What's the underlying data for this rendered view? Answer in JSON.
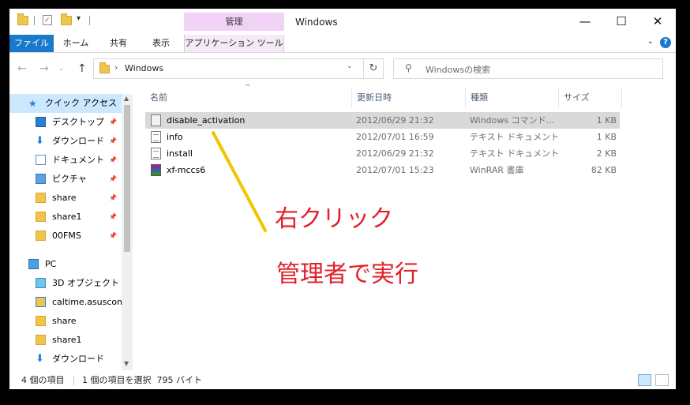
{
  "window": {
    "title": "Windows",
    "context_tab_header": "管理"
  },
  "ribbon": {
    "tabs": [
      "ファイル",
      "ホーム",
      "共有",
      "表示",
      "アプリケーション ツール"
    ]
  },
  "address": {
    "path": "Windows",
    "search_placeholder": "Windowsの検索"
  },
  "nav": {
    "items": [
      {
        "label": "クイック アクセス",
        "icon": "star-icon",
        "pinned": false
      },
      {
        "label": "デスクトップ",
        "icon": "desktop-icon",
        "pinned": true
      },
      {
        "label": "ダウンロード",
        "icon": "download-icon",
        "pinned": true
      },
      {
        "label": "ドキュメント",
        "icon": "document-icon",
        "pinned": true
      },
      {
        "label": "ピクチャ",
        "icon": "pictures-icon",
        "pinned": true
      },
      {
        "label": "share",
        "icon": "folder-icon",
        "pinned": true
      },
      {
        "label": "share1",
        "icon": "folder-icon",
        "pinned": true
      },
      {
        "label": "00FMS",
        "icon": "folder-icon",
        "pinned": true
      },
      {
        "label": "PC",
        "icon": "pc-icon",
        "pinned": false
      },
      {
        "label": "3D オブジェクト",
        "icon": "3d-objects-icon",
        "pinned": false
      },
      {
        "label": "caltime.asuscom",
        "icon": "network-folder-icon",
        "pinned": false
      },
      {
        "label": "share",
        "icon": "folder-icon",
        "pinned": false
      },
      {
        "label": "share1",
        "icon": "folder-icon",
        "pinned": false
      },
      {
        "label": "ダウンロード",
        "icon": "download-icon",
        "pinned": false
      }
    ]
  },
  "columns": {
    "name": "名前",
    "modified": "更新日時",
    "type": "種類",
    "size": "サイズ"
  },
  "files": [
    {
      "name": "disable_activation",
      "modified": "2012/06/29 21:32",
      "type": "Windows コマンド...",
      "size": "1 KB",
      "icon": "cmd-file-icon",
      "selected": true
    },
    {
      "name": "info",
      "modified": "2012/07/01 16:59",
      "type": "テキスト ドキュメント",
      "size": "1 KB",
      "icon": "text-file-icon",
      "selected": false
    },
    {
      "name": "install",
      "modified": "2012/06/29 21:32",
      "type": "テキスト ドキュメント",
      "size": "2 KB",
      "icon": "text-file-icon",
      "selected": false
    },
    {
      "name": "xf-mccs6",
      "modified": "2012/07/01 15:23",
      "type": "WinRAR 書庫",
      "size": "82 KB",
      "icon": "winrar-icon",
      "selected": false
    }
  ],
  "annotations": {
    "line1": "右クリック",
    "line2": "管理者で実行",
    "text_color": "#e0202a",
    "arrow_color": "#f2c500"
  },
  "status": {
    "item_count": "4 個の項目",
    "selection": "1 個の項目を選択  795 バイト"
  },
  "colors": {
    "file_tab": "#1979ca",
    "context_tab": "#f1d3f5",
    "selected_row": "#d9d9d9",
    "nav_selected": "#cce8ff"
  }
}
